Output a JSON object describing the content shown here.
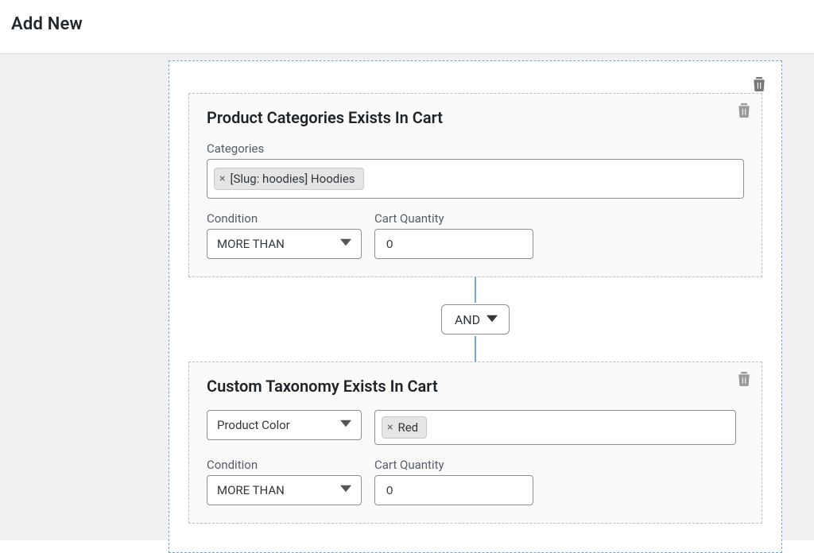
{
  "header": {
    "title": "Add New"
  },
  "card1": {
    "title": "Product Categories Exists In Cart",
    "categories": {
      "label": "Categories",
      "tags": [
        "[Slug: hoodies] Hoodies"
      ]
    },
    "condition": {
      "label": "Condition",
      "value": "MORE THAN"
    },
    "quantity": {
      "label": "Cart Quantity",
      "value": "0"
    }
  },
  "join": {
    "value": "AND"
  },
  "card2": {
    "title": "Custom Taxonomy Exists In Cart",
    "taxonomy": {
      "value": "Product Color"
    },
    "terms": {
      "tags": [
        "Red"
      ]
    },
    "condition": {
      "label": "Condition",
      "value": "MORE THAN"
    },
    "quantity": {
      "label": "Cart Quantity",
      "value": "0"
    }
  }
}
